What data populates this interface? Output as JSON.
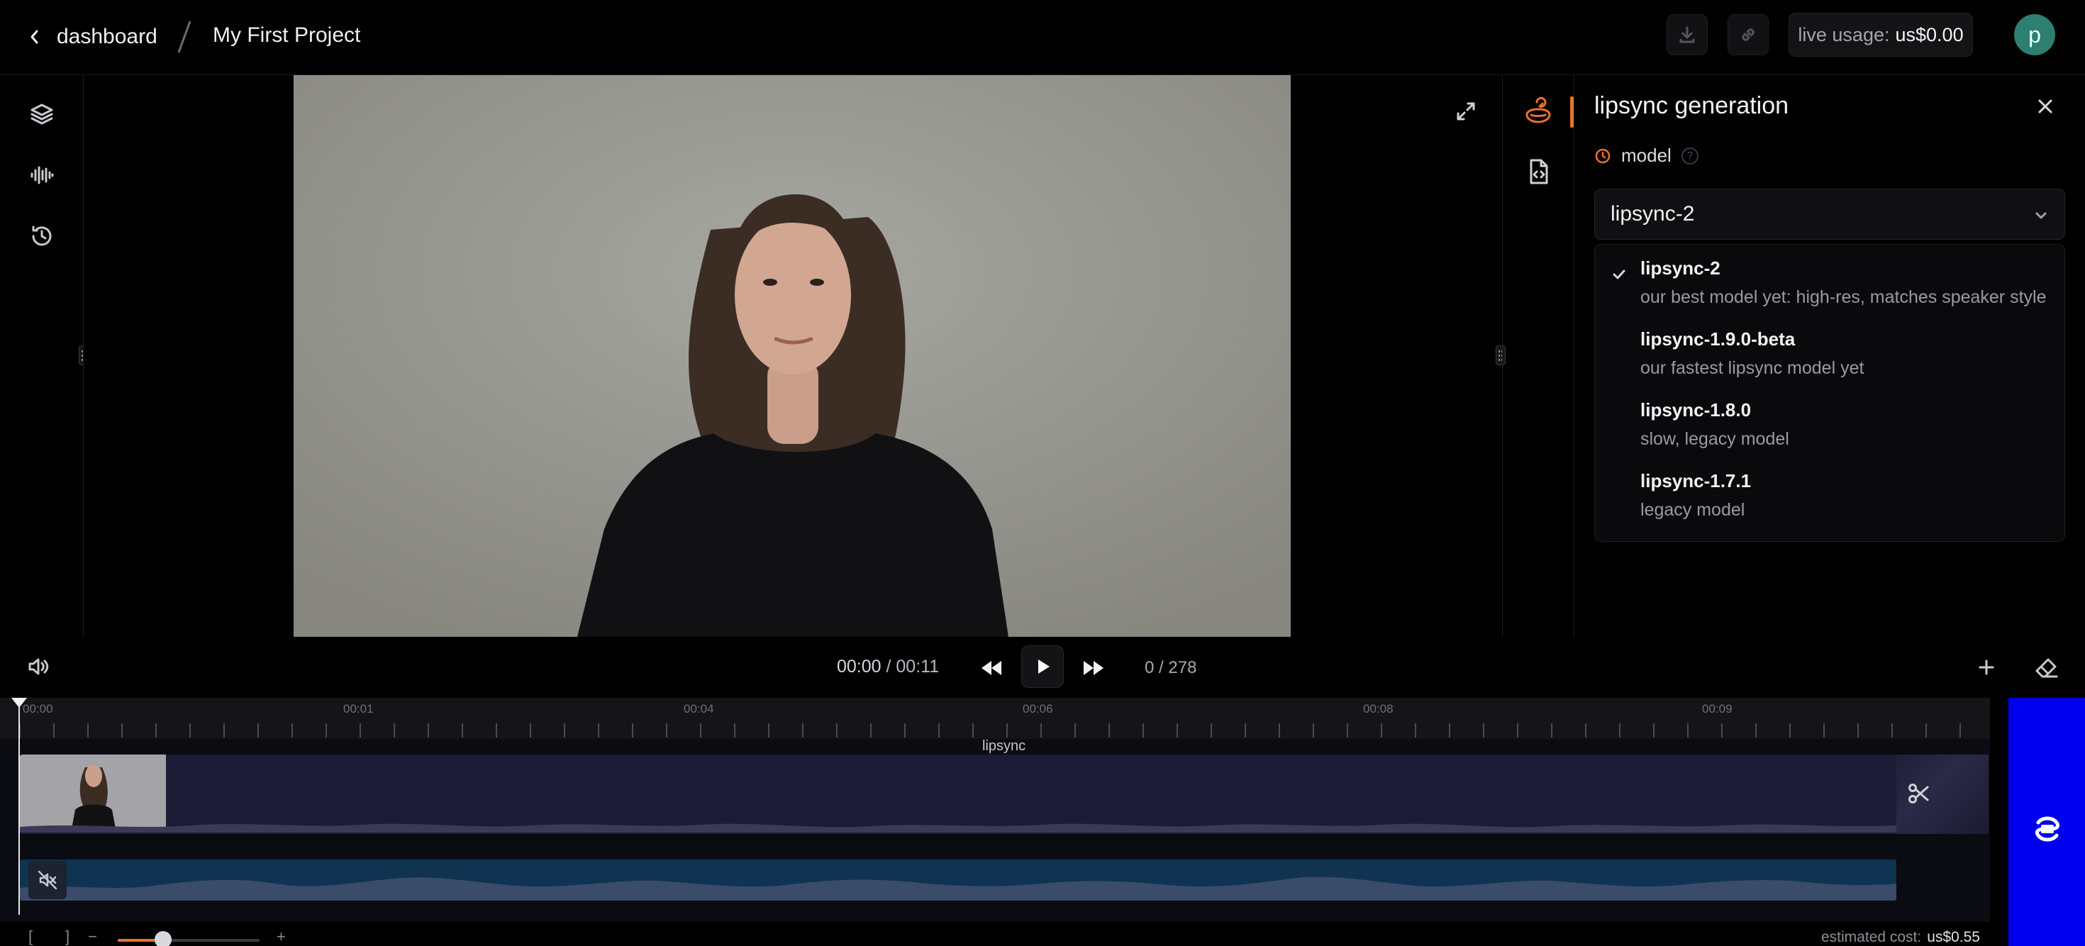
{
  "header": {
    "back_label": "dashboard",
    "project_title": "My First Project",
    "usage_label": "live usage:",
    "usage_value": "us$0.00",
    "avatar_initial": "p"
  },
  "panel": {
    "title": "lipsync generation",
    "model_label": "model",
    "help_glyph": "?",
    "selected_model": "lipsync-2",
    "options": [
      {
        "title": "lipsync-2",
        "desc": "our best model yet: high-res, matches speaker style",
        "selected": true
      },
      {
        "title": "lipsync-1.9.0-beta",
        "desc": "our fastest lipsync model yet",
        "selected": false
      },
      {
        "title": "lipsync-1.8.0",
        "desc": "slow, legacy model",
        "selected": false
      },
      {
        "title": "lipsync-1.7.1",
        "desc": "legacy model",
        "selected": false
      }
    ]
  },
  "transport": {
    "current_time": "00:00",
    "total_time": "00:11",
    "time_sep": " / ",
    "frame": "0",
    "frame_total": "278",
    "frame_sep": " / "
  },
  "timeline": {
    "ruler_labels": [
      "00:00",
      "00:01",
      "00:04",
      "00:06",
      "00:08",
      "00:09"
    ],
    "clip_label": "lipsync"
  },
  "footer": {
    "bracket_open": "[",
    "bracket_close": "]",
    "zoom_minus": "−",
    "zoom_plus": "+",
    "zoom_level": 0.32,
    "est_cost_label": "estimated cost:",
    "est_cost_value": "us$0.55"
  },
  "colors": {
    "accent": "#e8712f",
    "brand_blue": "#0000f0",
    "avatar_bg": "#2d7f72"
  },
  "icons": [
    "chevron-left-icon",
    "download-icon",
    "link-icon",
    "layers-icon",
    "waveform-icon",
    "history-icon",
    "expand-icon",
    "lipsync-tool-icon",
    "code-file-icon",
    "close-icon",
    "model-clock-icon",
    "chevron-down-icon",
    "check-icon",
    "volume-icon",
    "rewind-icon",
    "play-icon",
    "fast-forward-icon",
    "plus-icon",
    "eraser-icon",
    "scissors-icon",
    "mute-icon",
    "brand-logo-icon"
  ]
}
